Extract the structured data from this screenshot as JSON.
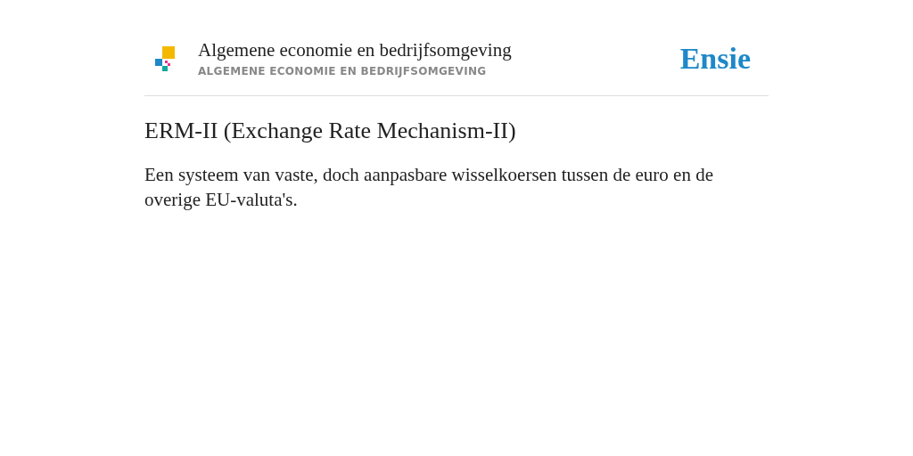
{
  "header": {
    "title": "Algemene economie en bedrijfsomgeving",
    "subtitle": "ALGEMENE ECONOMIE EN BEDRIJFSOMGEVING",
    "brand": "Ensie"
  },
  "entry": {
    "heading": "ERM-II (Exchange Rate Mechanism-II)",
    "definition": "Een systeem van vaste, doch aanpasbare wisselkoersen tussen de euro en de overige EU-valuta's."
  }
}
